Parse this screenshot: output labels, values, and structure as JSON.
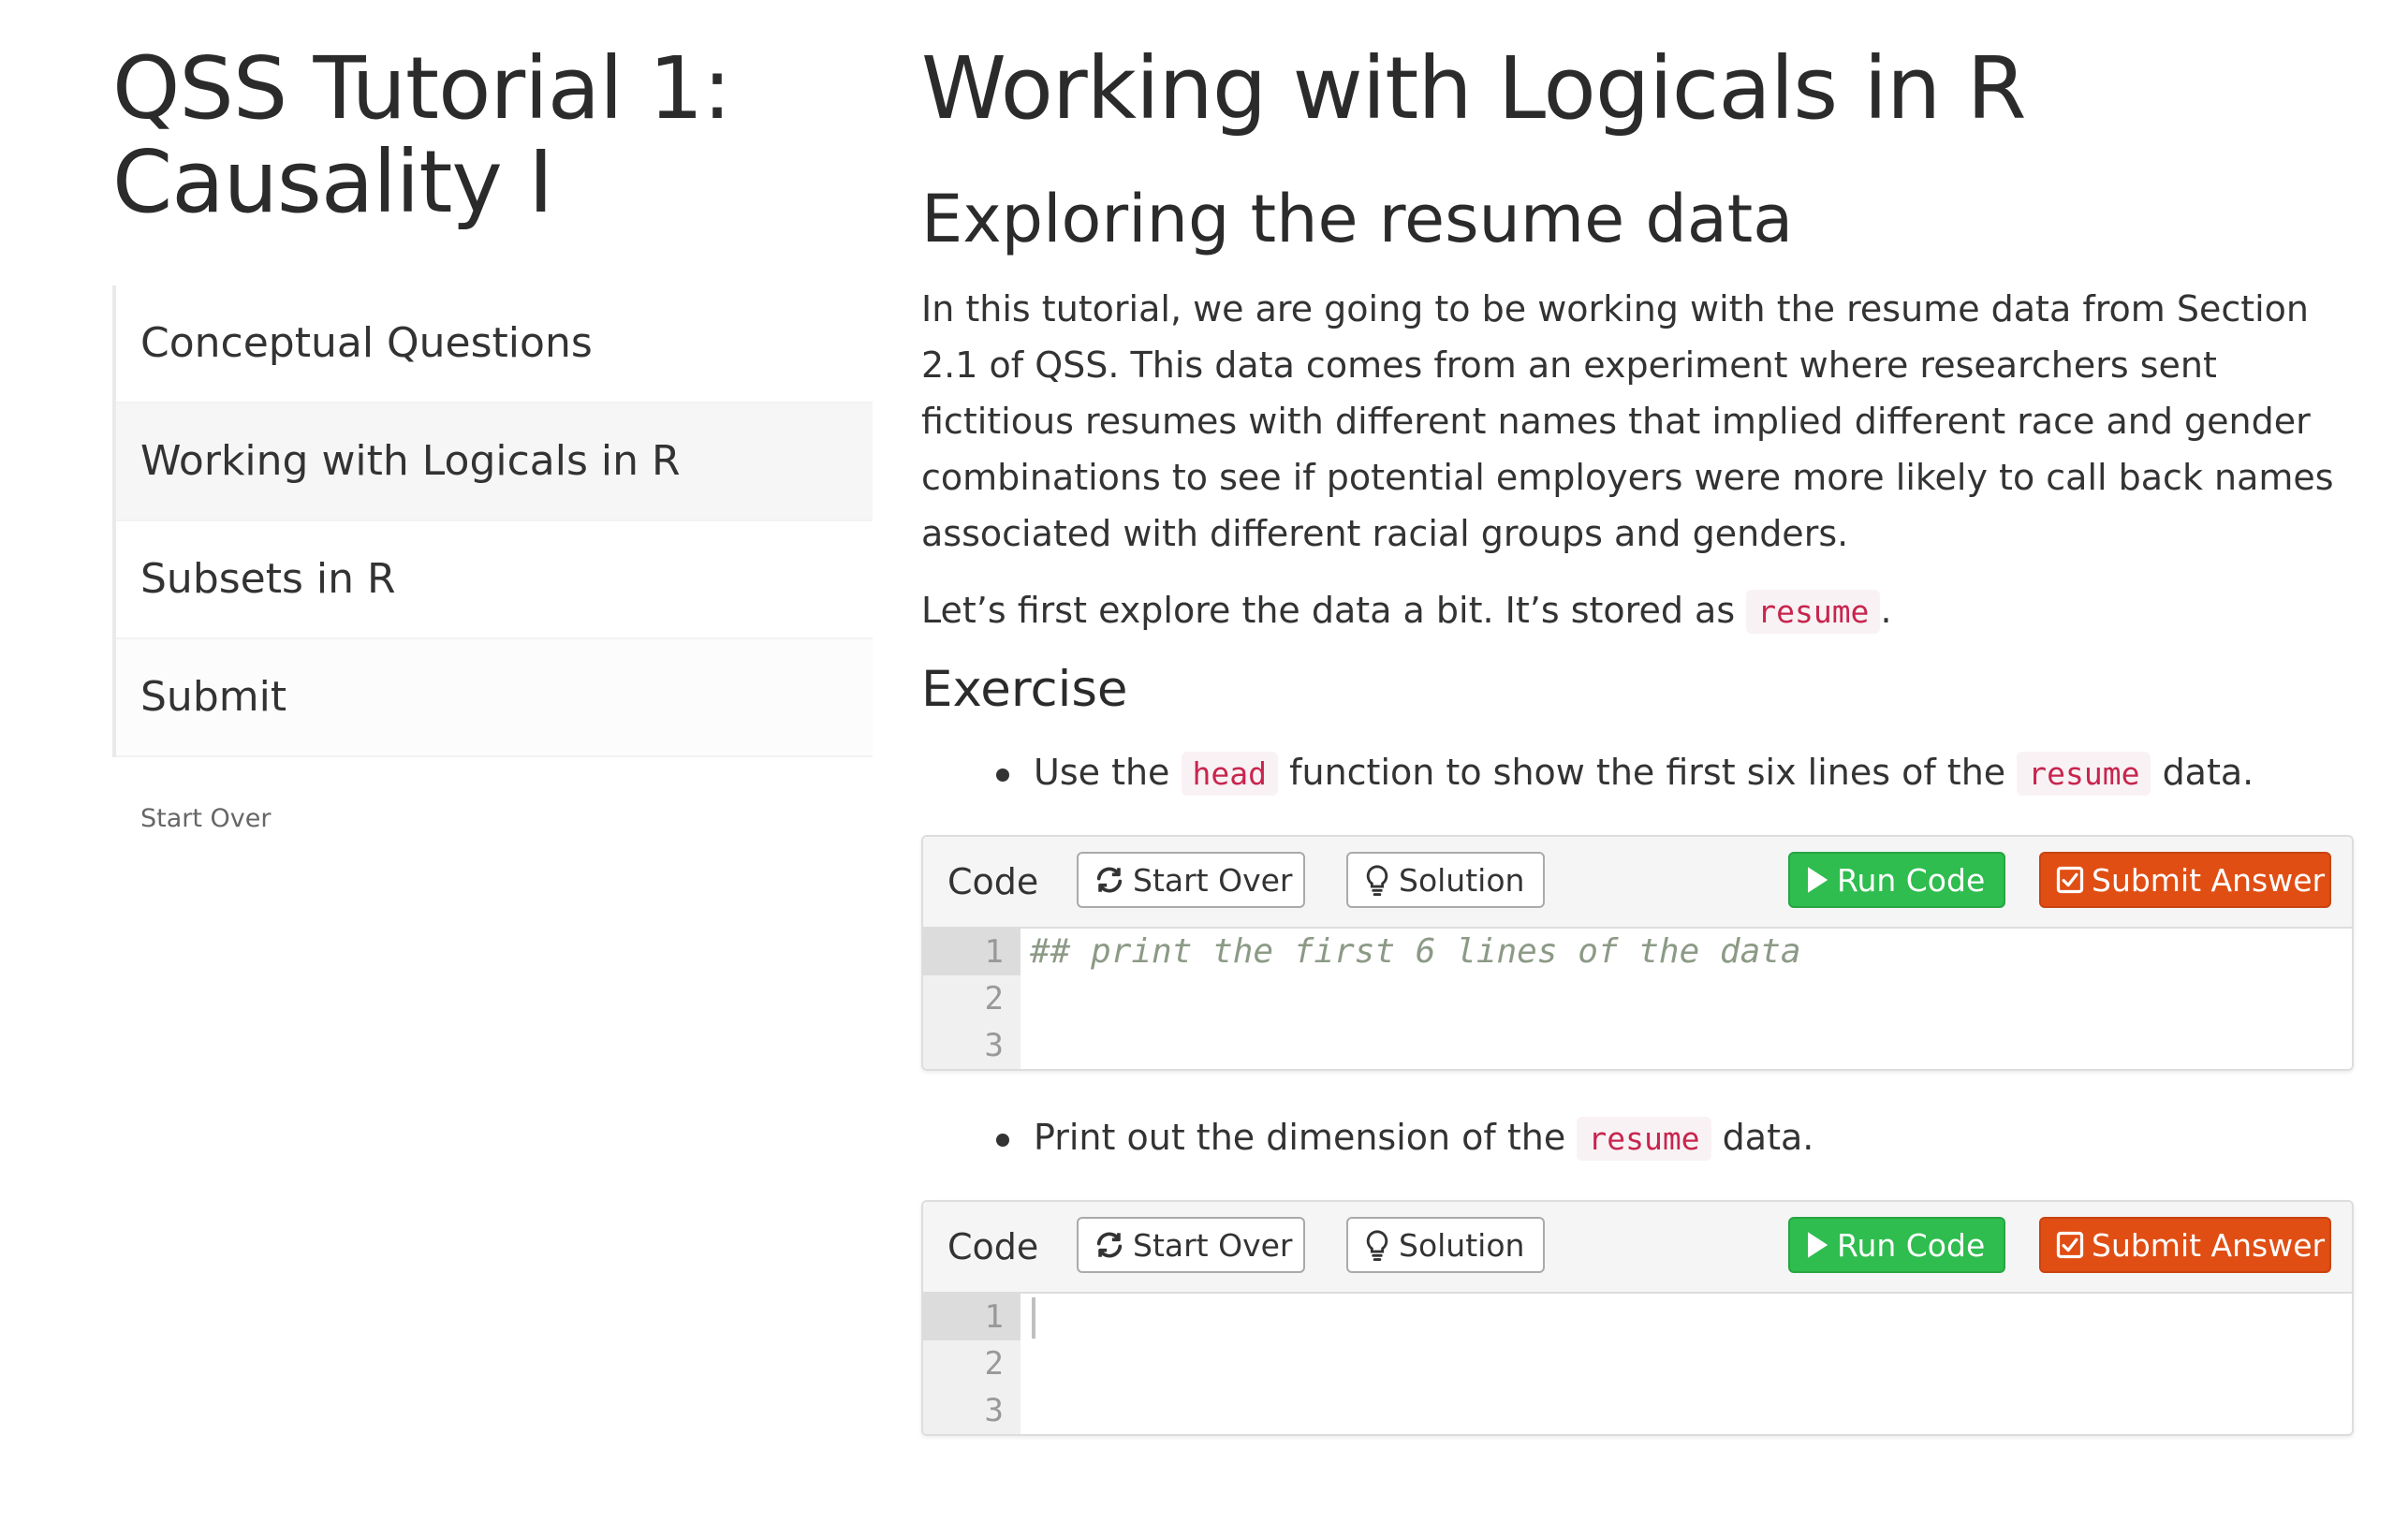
{
  "sidebar": {
    "title_line1": "QSS Tutorial 1:",
    "title_line2": "Causality I",
    "topics": [
      {
        "label": "Conceptual Questions"
      },
      {
        "label": "Working with Logicals in R"
      },
      {
        "label": "Subsets in R"
      },
      {
        "label": "Submit"
      }
    ],
    "active_topic": "Working with Logicals in R",
    "start_over": "Start Over"
  },
  "main": {
    "section_title": "Working with Logicals in R",
    "subsection_title": "Exploring the resume data",
    "intro_paragraph": "In this tutorial, we are going to be working with the resume data from Section 2.1 of QSS. This data comes from an experiment where researchers sent fictitious resumes with different names that implied different race and gender combinations to see if potential employers were more likely to call back names associated with different racial groups and genders.",
    "explore_text": "Let’s first explore the data a bit. It’s stored as",
    "explore_code": "resume",
    "explore_suffix": ".",
    "exercise_heading": "Exercise",
    "bullet1": {
      "prefix": "Use the",
      "code1": "head",
      "middle": "function to show the first six lines of the",
      "code2": "resume",
      "suffix": "data."
    },
    "bullet2": {
      "prefix": "Print out the dimension of the",
      "code": "resume",
      "suffix": "data."
    }
  },
  "panel": {
    "label": "Code",
    "start_over": "Start Over",
    "solution": "Solution",
    "run_code": "Run Code",
    "submit": "Submit Answer",
    "line_numbers": [
      "1",
      "2",
      "3"
    ]
  },
  "exercise1": {
    "code_lines": [
      "## print the first 6 lines of the data",
      "",
      ""
    ]
  },
  "exercise2": {
    "code_lines": [
      "",
      "",
      ""
    ]
  },
  "colors": {
    "run_button": "#2ebd4e",
    "submit_button": "#e04e14",
    "inline_code": "#c7254e",
    "comment": "#8c9a86"
  }
}
